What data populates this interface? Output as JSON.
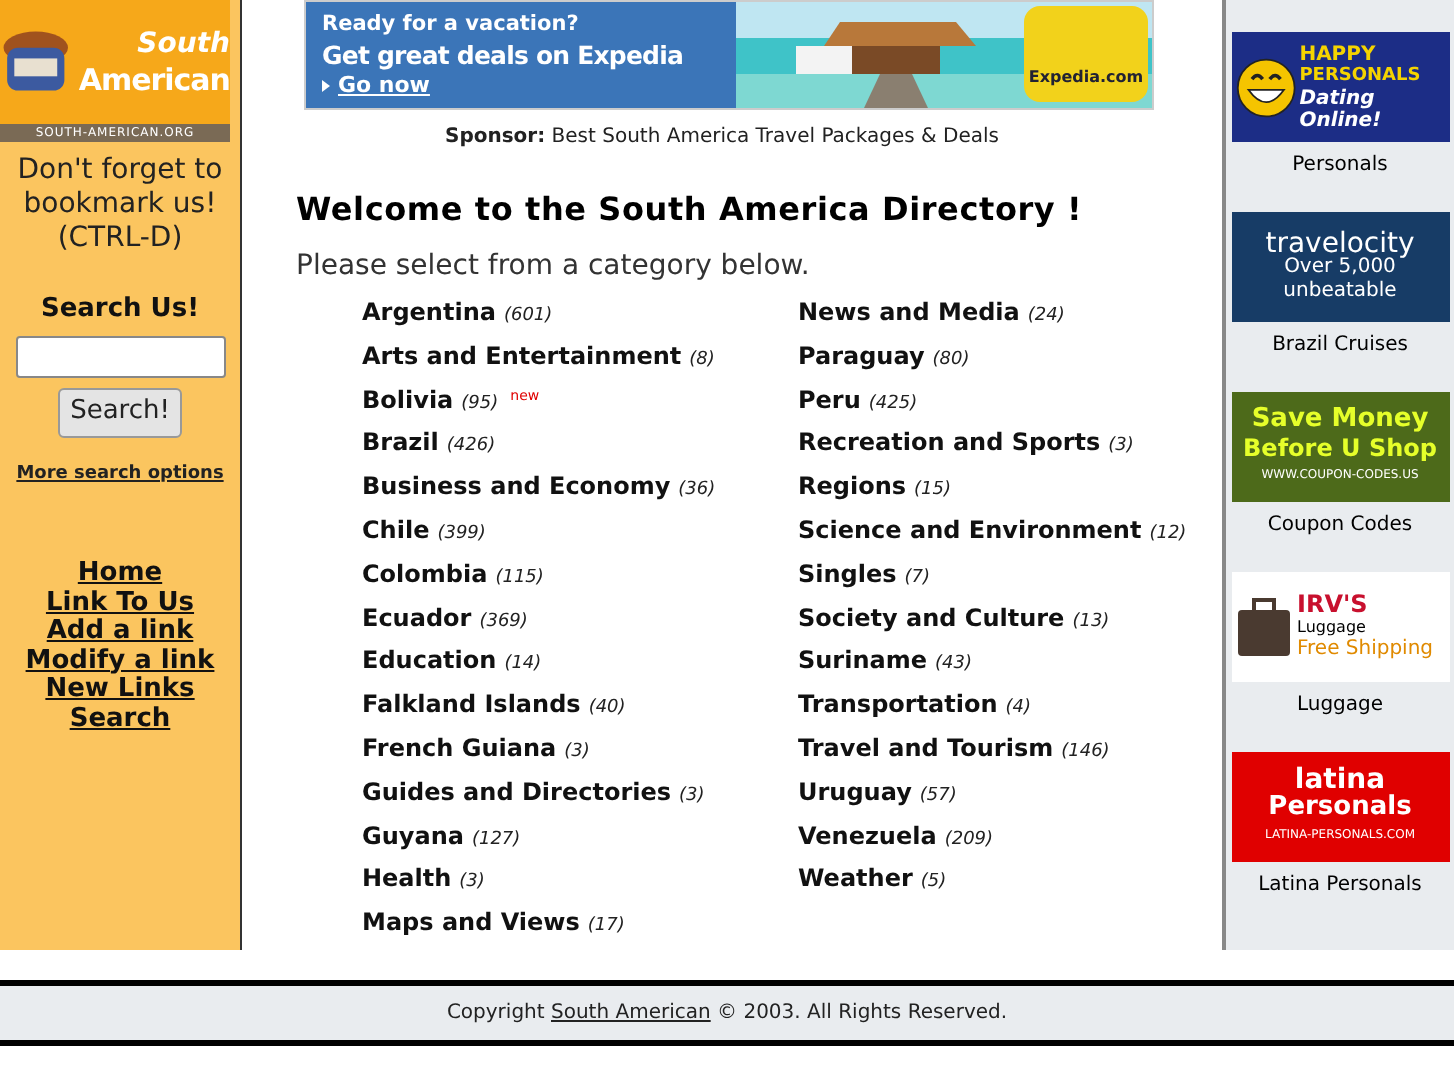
{
  "logo": {
    "title_top": "South",
    "title_bottom": "American",
    "domain": "SOUTH-AMERICAN.ORG"
  },
  "sidebar": {
    "bookmark_note": "Don't forget to bookmark us! (CTRL-D)",
    "search_title": "Search Us!",
    "search_button": "Search!",
    "more_search": "More search options",
    "links": [
      "Home",
      "Link To Us",
      "Add a link",
      "Modify a link",
      "New Links",
      "Search"
    ]
  },
  "banner": {
    "line_1": "Ready for a vacation?",
    "line_2": "Get great deals on Expedia",
    "link": "Go now",
    "brand": "Expedia.com"
  },
  "sponsor": {
    "label": "Sponsor:",
    "link": "Best South America Travel Packages & Deals"
  },
  "heading": "Welcome to the South America Directory !",
  "intro": "Please select from a category below.",
  "categories": [
    [
      {
        "name": "Argentina",
        "count": "(601)"
      },
      {
        "name": "Arts and Entertainment",
        "count": "(8)"
      },
      {
        "name": "Bolivia",
        "count": "(95)",
        "badge": "new"
      },
      {
        "name": "Brazil",
        "count": "(426)"
      },
      {
        "name": "Business and Economy",
        "count": "(36)"
      },
      {
        "name": "Chile",
        "count": "(399)"
      },
      {
        "name": "Colombia",
        "count": "(115)"
      },
      {
        "name": "Ecuador",
        "count": "(369)"
      },
      {
        "name": "Education",
        "count": "(14)"
      },
      {
        "name": "Falkland Islands",
        "count": "(40)"
      },
      {
        "name": "French Guiana",
        "count": "(3)"
      },
      {
        "name": "Guides and Directories",
        "count": "(3)"
      },
      {
        "name": "Guyana",
        "count": "(127)"
      },
      {
        "name": "Health",
        "count": "(3)"
      },
      {
        "name": "Maps and Views",
        "count": "(17)"
      }
    ],
    [
      {
        "name": "News and Media",
        "count": "(24)"
      },
      {
        "name": "Paraguay",
        "count": "(80)"
      },
      {
        "name": "Peru",
        "count": "(425)"
      },
      {
        "name": "Recreation and Sports",
        "count": "(3)"
      },
      {
        "name": "Regions",
        "count": "(15)"
      },
      {
        "name": "Science and Environment",
        "count": "(12)"
      },
      {
        "name": "Singles",
        "count": "(7)"
      },
      {
        "name": "Society and Culture",
        "count": "(13)"
      },
      {
        "name": "Suriname",
        "count": "(43)"
      },
      {
        "name": "Transportation",
        "count": "(4)"
      },
      {
        "name": "Travel and Tourism",
        "count": "(146)"
      },
      {
        "name": "Uruguay",
        "count": "(57)"
      },
      {
        "name": "Venezuela",
        "count": "(209)"
      },
      {
        "name": "Weather",
        "count": "(5)"
      }
    ]
  ],
  "ads": [
    {
      "kind": "personals",
      "lines": [
        "HAPPY",
        "PERSONALS",
        "Dating Online!"
      ],
      "caption": "Personals"
    },
    {
      "kind": "travel",
      "lines": [
        "travelocity",
        "Over 5,000",
        "unbeatable"
      ],
      "caption": "Brazil Cruises"
    },
    {
      "kind": "coupon",
      "lines": [
        "Save Money",
        "Before U Shop",
        "WWW.COUPON-CODES.US"
      ],
      "caption": "Coupon Codes"
    },
    {
      "kind": "luggage",
      "lines": [
        "IRV'S",
        "Luggage",
        "Free Shipping"
      ],
      "caption": "Luggage"
    },
    {
      "kind": "latina",
      "lines": [
        "latina",
        "Personals",
        "LATINA-PERSONALS.COM"
      ],
      "caption": "Latina Personals"
    }
  ],
  "footer": {
    "before": "Copyright",
    "link": "South American",
    "after": "© 2003. All Rights Reserved."
  }
}
